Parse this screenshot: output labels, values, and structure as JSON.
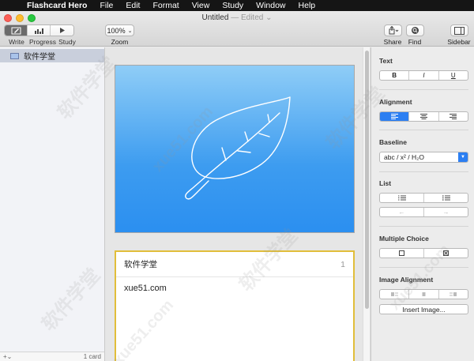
{
  "menubar": {
    "apple_icon": "apple-icon",
    "items": [
      "Flashcard Hero",
      "File",
      "Edit",
      "Format",
      "View",
      "Study",
      "Window",
      "Help"
    ]
  },
  "window": {
    "title": "Untitled",
    "edited": "— Edited",
    "title_dropdown_icon": "chevron-down-icon"
  },
  "toolbar": {
    "modes": [
      {
        "label": "Write",
        "icon": "pencil-icon",
        "active": true
      },
      {
        "label": "Progress",
        "icon": "bar-chart-icon",
        "active": false
      },
      {
        "label": "Study",
        "icon": "play-icon",
        "active": false
      }
    ],
    "zoom_value": "100%",
    "zoom_label": "Zoom",
    "share_label": "Share",
    "find_label": "Find",
    "sidebar_label": "Sidebar"
  },
  "sidebar": {
    "deck_name": "软件学堂",
    "add_label": "+",
    "card_count": "1 card"
  },
  "card": {
    "question": "软件学堂",
    "number": "1",
    "answer": "xue51.com"
  },
  "inspector": {
    "text": {
      "title": "Text",
      "bold": "B",
      "italic": "I",
      "underline": "U"
    },
    "alignment": {
      "title": "Alignment"
    },
    "baseline": {
      "title": "Baseline",
      "value": "abc / x² / H₂O"
    },
    "list": {
      "title": "List"
    },
    "multiple_choice": {
      "title": "Multiple Choice"
    },
    "image_alignment": {
      "title": "Image Alignment",
      "insert_label": "Insert Image..."
    }
  },
  "watermark": {
    "cn": "软件学堂",
    "url": "xue51.com"
  },
  "colors": {
    "accent": "#2c7ff2",
    "card_border": "#e1be3a",
    "card_gradient_top": "#8fcdf7",
    "card_gradient_bottom": "#2b8ff0"
  }
}
